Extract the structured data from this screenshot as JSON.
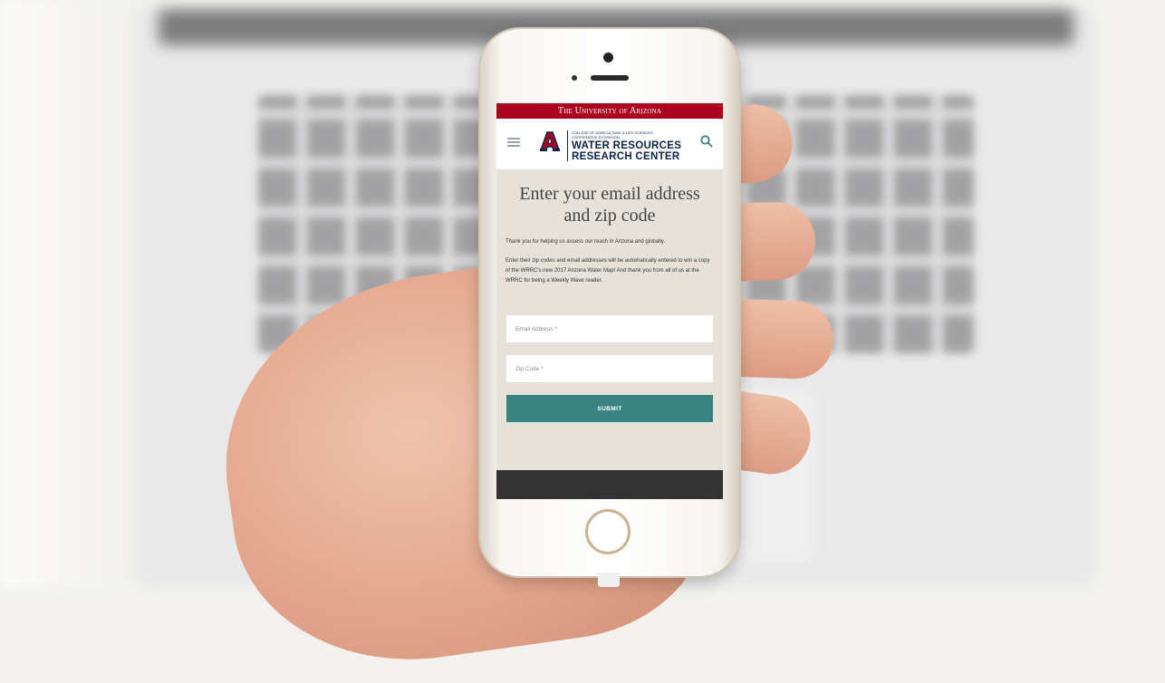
{
  "university_bar": {
    "label": "The University of Arizona"
  },
  "header": {
    "logo_subtitle": "College of Agriculture & Life Sciences Cooperative Extension",
    "logo_title_line1": "WATER RESOURCES",
    "logo_title_line2": "RESEARCH CENTER"
  },
  "form": {
    "heading": "Enter your email address and zip code",
    "intro": "Thank you for helping us assess our reach in Arizona and globally.",
    "details": "Enter their zip codes and email addresses will be automatically entered to win a copy of the WRRC's new 2017 Arizona Water Map! And thank you from all of us at the WRRC for being a Weekly Wave reader.",
    "email_placeholder": "Email Address *",
    "zip_placeholder": "Zip Code *",
    "submit_label": "SUBMIT"
  },
  "colors": {
    "university_red": "#ab0520",
    "navy": "#0c234b",
    "submit_teal": "#378382",
    "page_bg": "#e6e2d9"
  },
  "icons": {
    "menu": "hamburger-menu-icon",
    "search": "search-icon",
    "logo": "block-a-logo-icon"
  }
}
